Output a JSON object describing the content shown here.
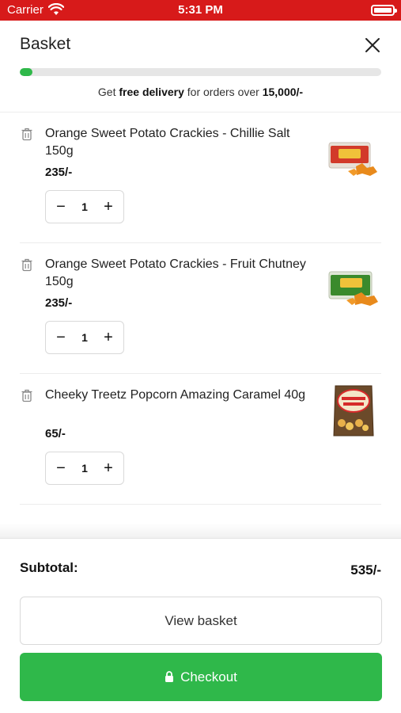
{
  "status_bar": {
    "carrier": "Carrier",
    "time": "5:31 PM"
  },
  "header": {
    "title": "Basket",
    "close_icon": "close-icon"
  },
  "delivery": {
    "progress_fraction": 0.035,
    "text_before": "Get ",
    "text_bold": "free delivery",
    "text_middle": " for orders over ",
    "threshold": "15,000/-"
  },
  "items": [
    {
      "name": "Orange Sweet Potato Crackies - Chillie Salt 150g",
      "price": "235/-",
      "quantity": "1",
      "image_icon": "chillie-salt-crackies-pack"
    },
    {
      "name": "Orange Sweet Potato Crackies - Fruit Chutney 150g",
      "price": "235/-",
      "quantity": "1",
      "image_icon": "fruit-chutney-crackies-pack"
    },
    {
      "name": "Cheeky Treetz Popcorn Amazing Caramel 40g",
      "price": "65/-",
      "quantity": "1",
      "image_icon": "popcorn-bag"
    }
  ],
  "stepper": {
    "minus": "−",
    "plus": "+"
  },
  "footer": {
    "subtotal_label": "Subtotal:",
    "subtotal_value": "535/-",
    "view_basket_label": "View basket",
    "checkout_label": "Checkout"
  },
  "colors": {
    "status_bar": "#d71a1a",
    "accent_green": "#2fb84a"
  }
}
